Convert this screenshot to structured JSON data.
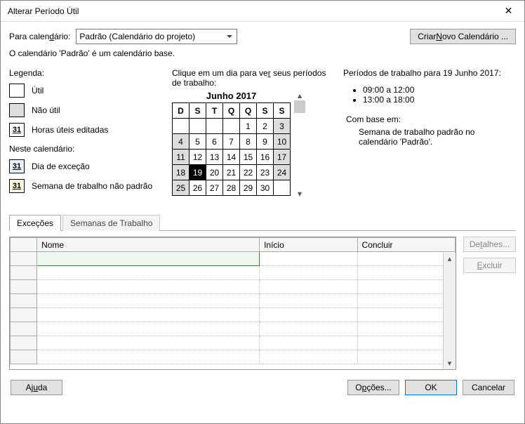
{
  "window": {
    "title": "Alterar Período Útil"
  },
  "toolbar": {
    "para_calendario_label": "Para calendário:",
    "para_calendario_value": "Padrão (Calendário do projeto)",
    "criar_novo": "Criar Novo Calendário ..."
  },
  "info": "O calendário 'Padrão' é um calendário base.",
  "legend": {
    "title": "Legenda:",
    "util": "Útil",
    "nao_util": "Não útil",
    "horas_editadas": "Horas úteis editadas",
    "subtitle": "Neste calendário:",
    "dia_excecao": "Dia de exceção",
    "semana_nao_padrao": "Semana de trabalho não padrão",
    "num31": "31"
  },
  "calendar": {
    "prompt": "Clique em um dia para ver seus períodos de trabalho:",
    "month": "Junho 2017",
    "headers": [
      "D",
      "S",
      "T",
      "Q",
      "Q",
      "S",
      "S"
    ],
    "grid": [
      [
        "",
        "",
        "",
        "",
        "1",
        "2",
        "3"
      ],
      [
        "4",
        "5",
        "6",
        "7",
        "8",
        "9",
        "10"
      ],
      [
        "11",
        "12",
        "13",
        "14",
        "15",
        "16",
        "17"
      ],
      [
        "18",
        "19",
        "20",
        "21",
        "22",
        "23",
        "24"
      ],
      [
        "25",
        "26",
        "27",
        "28",
        "29",
        "30",
        ""
      ]
    ],
    "selected_day": "19"
  },
  "workperiods": {
    "heading": "Períodos de trabalho para 19 Junho 2017:",
    "slots": [
      "09:00 a 12:00",
      "13:00 a 18:00"
    ],
    "basis_label": "Com base em:",
    "basis_text": "Semana de trabalho padrão no calendário 'Padrão'."
  },
  "tabs": {
    "excecoes": "Exceções",
    "semanas": "Semanas de Trabalho"
  },
  "gridheaders": {
    "nome": "Nome",
    "inicio": "Início",
    "concluir": "Concluir"
  },
  "sidebuttons": {
    "detalhes": "Detalhes...",
    "excluir": "Excluir"
  },
  "footer": {
    "ajuda": "Ajuda",
    "opcoes": "Opções...",
    "ok": "OK",
    "cancelar": "Cancelar"
  }
}
